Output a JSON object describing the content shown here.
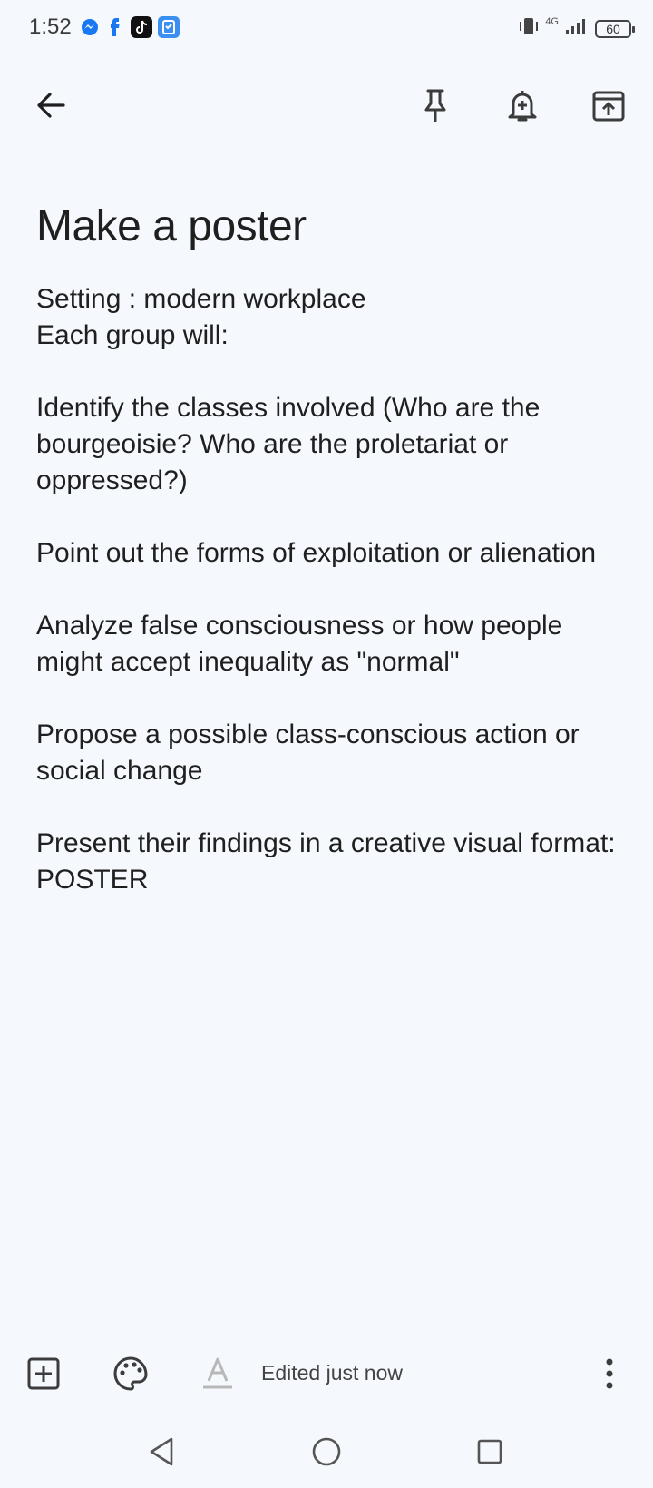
{
  "status_bar": {
    "time": "1:52",
    "network": "4G",
    "battery": "60",
    "notification_icons": [
      "messenger-icon",
      "facebook-icon",
      "tiktok-icon",
      "app-badge-icon"
    ]
  },
  "toolbar": {
    "back_icon": "arrow-left-icon",
    "pin_icon": "pin-icon",
    "reminder_icon": "bell-plus-icon",
    "archive_icon": "archive-icon"
  },
  "note": {
    "title": "Make a poster",
    "body": "Setting : modern workplace\nEach group will:\n\nIdentify the classes involved (Who are the bourgeoisie? Who are the proletariat or oppressed?)\n\nPoint out the forms of exploitation or alienation\n\nAnalyze false consciousness or how people might accept inequality as \"normal\"\n\nPropose a possible class-conscious action or social change\n\nPresent their findings in a creative visual format: POSTER"
  },
  "bottom_bar": {
    "edited_label": "Edited just now",
    "add_icon": "add-box-icon",
    "palette_icon": "palette-icon",
    "text_format_icon": "text-format-icon",
    "more_icon": "more-vert-icon"
  },
  "colors": {
    "background": "#f5f8fc",
    "text": "#1f1f1f",
    "muted": "#444444"
  }
}
